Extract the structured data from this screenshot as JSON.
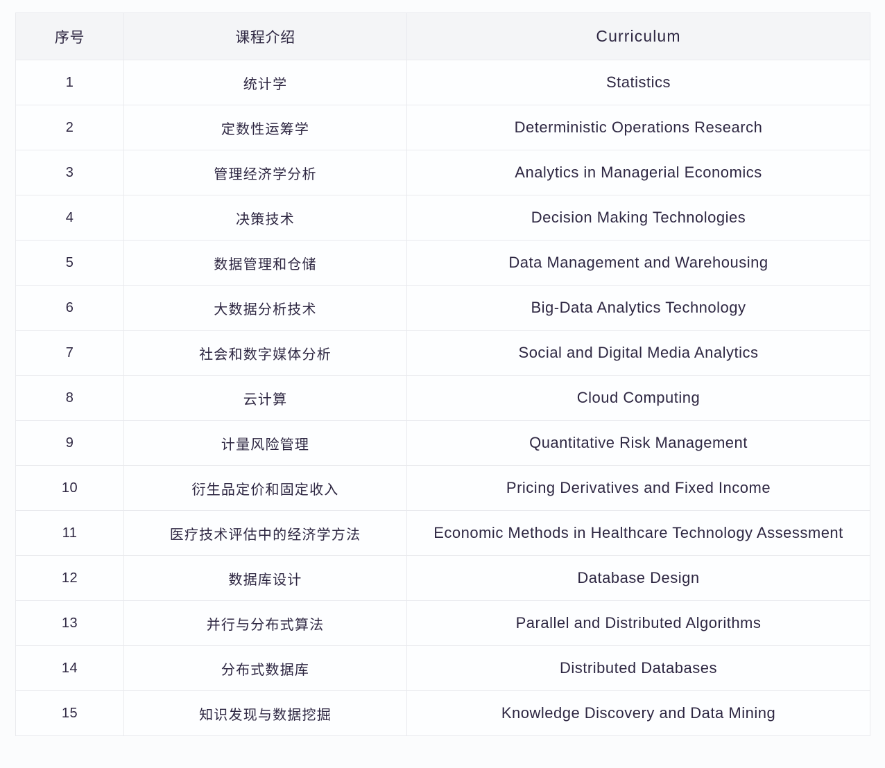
{
  "table": {
    "headers": {
      "no": "序号",
      "cn": "课程介绍",
      "en": "Curriculum"
    },
    "rows": [
      {
        "no": "1",
        "cn": "统计学",
        "en": "Statistics"
      },
      {
        "no": "2",
        "cn": "定数性运筹学",
        "en": "Deterministic Operations Research"
      },
      {
        "no": "3",
        "cn": "管理经济学分析",
        "en": "Analytics in Managerial Economics"
      },
      {
        "no": "4",
        "cn": "决策技术",
        "en": "Decision Making Technologies"
      },
      {
        "no": "5",
        "cn": "数据管理和仓储",
        "en": "Data Management and Warehousing"
      },
      {
        "no": "6",
        "cn": "大数据分析技术",
        "en": "Big-Data Analytics Technology"
      },
      {
        "no": "7",
        "cn": "社会和数字媒体分析",
        "en": "Social and Digital Media Analytics"
      },
      {
        "no": "8",
        "cn": "云计算",
        "en": "Cloud Computing"
      },
      {
        "no": "9",
        "cn": "计量风险管理",
        "en": "Quantitative Risk Management"
      },
      {
        "no": "10",
        "cn": "衍生品定价和固定收入",
        "en": "Pricing Derivatives and Fixed Income"
      },
      {
        "no": "11",
        "cn": "医疗技术评估中的经济学方法",
        "en": "Economic Methods in Healthcare Technology Assessment"
      },
      {
        "no": "12",
        "cn": "数据库设计",
        "en": "Database Design"
      },
      {
        "no": "13",
        "cn": "并行与分布式算法",
        "en": "Parallel and Distributed Algorithms"
      },
      {
        "no": "14",
        "cn": "分布式数据库",
        "en": "Distributed Databases"
      },
      {
        "no": "15",
        "cn": "知识发现与数据挖掘",
        "en": "Knowledge Discovery and Data Mining"
      }
    ]
  },
  "colors": {
    "text": "#2e2742",
    "header_bg": "#f4f5f7",
    "row_bg": "#fdfeff",
    "border": "#e9eaee",
    "page_bg": "#fbfcfd"
  }
}
